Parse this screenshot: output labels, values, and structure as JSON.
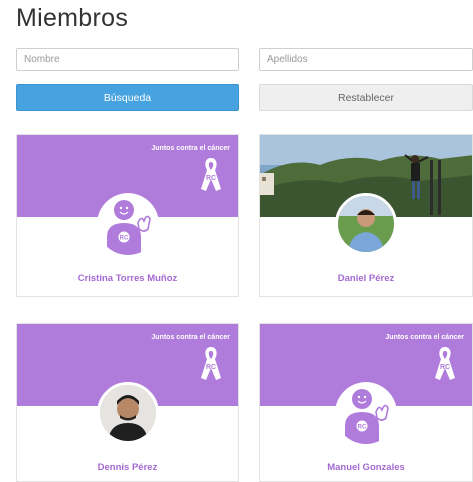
{
  "page": {
    "title": "Miembros"
  },
  "search": {
    "first_name_placeholder": "Nombre",
    "last_name_placeholder": "Apellidos",
    "search_label": "Búsqueda",
    "reset_label": "Restablecer"
  },
  "members": [
    {
      "name": "Cristina Torres Muñoz",
      "banner": "Juntos contra el cáncer",
      "avatar": "default"
    },
    {
      "name": "Daniel Pérez",
      "banner": "",
      "avatar": "photo"
    },
    {
      "name": "Dennis Pérez",
      "banner": "Juntos contra el cáncer",
      "avatar": "photo"
    },
    {
      "name": "Manuel Gonzales",
      "banner": "Juntos contra el cáncer",
      "avatar": "default"
    }
  ],
  "logo_text": "RC",
  "colors": {
    "accent": "#46a3e0",
    "purple": "#b07cdc",
    "name": "#a56ad2"
  }
}
